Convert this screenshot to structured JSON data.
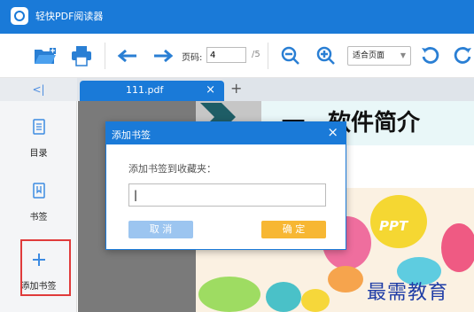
{
  "app": {
    "title": "轻快PDF阅读器"
  },
  "toolbar": {
    "open_icon": "folder-open-icon",
    "print_icon": "printer-icon",
    "prev_icon": "arrow-left-icon",
    "next_icon": "arrow-right-icon",
    "page_label": "页码:",
    "page_value": "4",
    "page_total": "/5",
    "zoom_out_icon": "zoom-out-icon",
    "zoom_in_icon": "zoom-in-icon",
    "zoom_mode": "适合页面",
    "rotate_left_icon": "rotate-left-icon",
    "rotate_right_icon": "rotate-right-icon"
  },
  "tabs": {
    "collapse": "<|",
    "items": [
      {
        "label": "111.pdf"
      }
    ],
    "close": "×",
    "add": "+"
  },
  "sidebar": {
    "items": [
      {
        "label": "目录",
        "icon": "toc-icon"
      },
      {
        "label": "书签",
        "icon": "bookmark-icon"
      },
      {
        "label": "添加书签",
        "icon": "add-bookmark-icon"
      }
    ]
  },
  "document": {
    "heading": "一　软件简介",
    "ppt_text": "PPT"
  },
  "dialog": {
    "title": "添加书签",
    "close": "×",
    "prompt": "添加书签到收藏夹：",
    "input_value": "|",
    "cancel_label": "取 消",
    "ok_label": "确 定"
  },
  "watermark": "最需教育",
  "colors": {
    "accent": "#1a7ad8",
    "ok_button": "#f7b733",
    "cancel_button": "#9cc5f0",
    "highlight": "#e03b3b"
  }
}
